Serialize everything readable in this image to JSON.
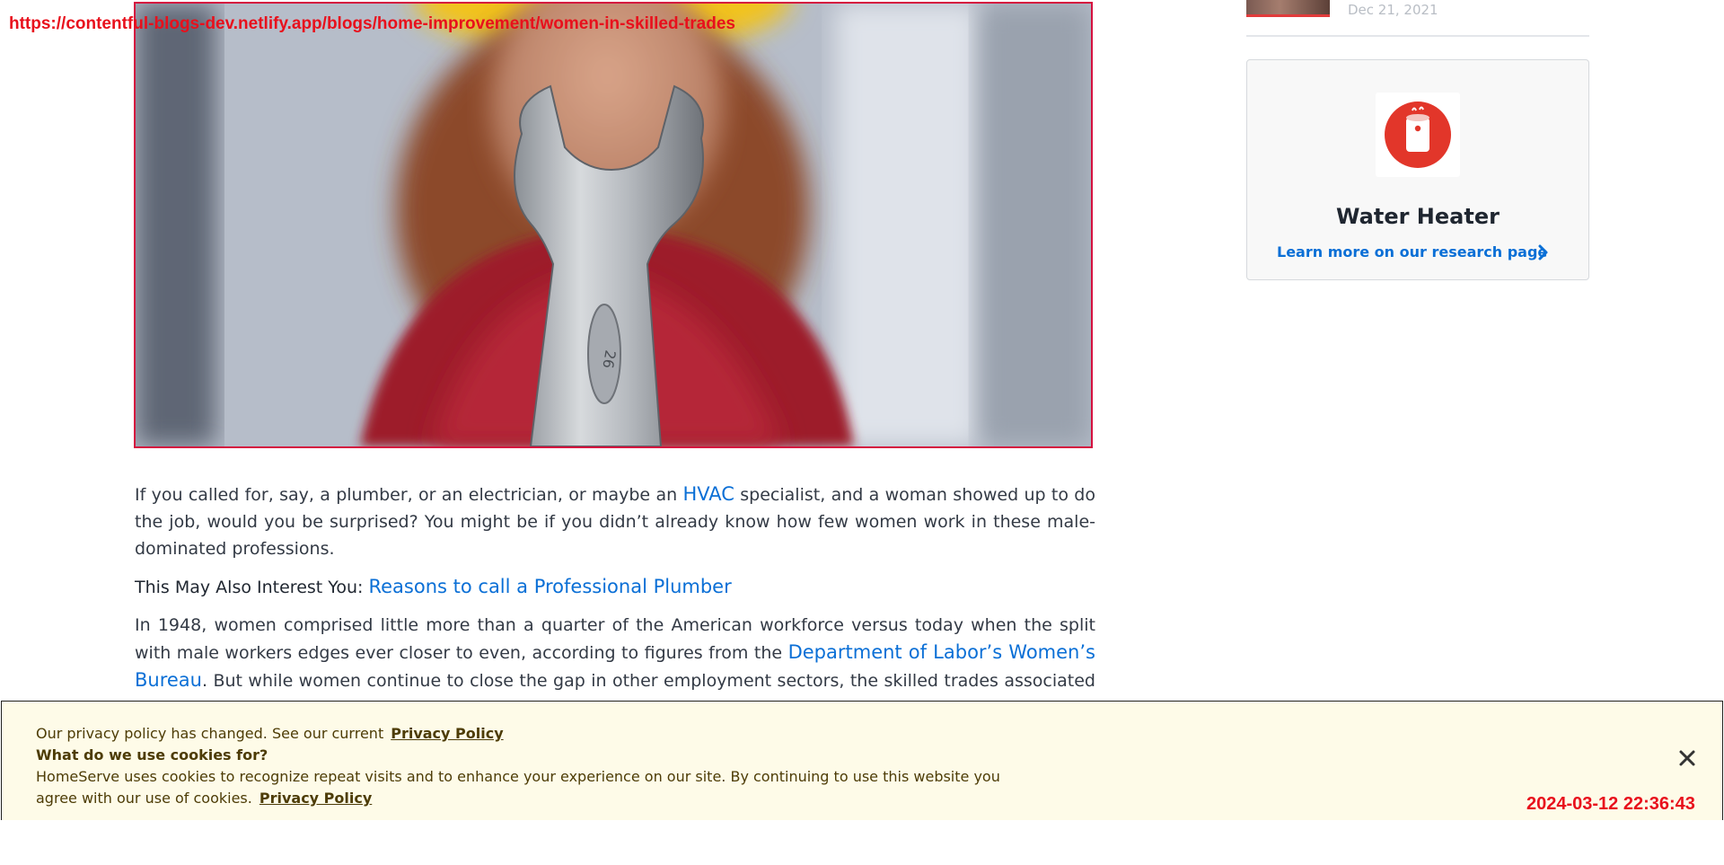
{
  "overlay": {
    "url": "https://contentful-blogs-dev.netlify.app/blogs/home-improvement/women-in-skilled-trades",
    "timestamp": "2024-03-12 22:36:43"
  },
  "hero": {
    "image_semantic": "wrench held in front of blurred worker in hard hat",
    "wrench_marking": "26"
  },
  "article": {
    "p1_before": "If you called for, say, a plumber, or an electrician, or maybe an ",
    "p1_link": "HVAC",
    "p1_after": " specialist, and a woman showed up to do the job, would you be surprised? You might be if you didn’t already know how few women work in these male-dominated professions.",
    "interest_label": "This May Also Interest You: ",
    "interest_link": "Reasons to call a Professional Plumber",
    "p2_before": "In 1948, women comprised little more than a quarter of the American workforce versus today when the split with male workers edges ever closer to even, according to figures from the ",
    "p2_link": "Department of Labor’s Women’s Bureau",
    "p2_after": ". But while women continue to close the gap in other employment sectors, the skilled trades associated with the core functions of"
  },
  "sidebar": {
    "recent_post_date": "Dec 21, 2021",
    "card_title": "Water Heater",
    "card_link": "Learn more on our research page",
    "icon_color": "#e2362a"
  },
  "cookie": {
    "line1_text": "Our privacy policy has changed. See our current",
    "line1_link": "Privacy Policy",
    "line2_text": "What do we use cookies for?",
    "line3_text": "HomeServe uses cookies to recognize repeat visits and to enhance your experience on our site. By continuing to use this website you",
    "line4_text": "agree with our use of cookies.",
    "line4_link": "Privacy Policy"
  },
  "colors": {
    "link": "#0a6fd6",
    "overlay_red": "#e8101c",
    "banner_bg": "#fefbe8",
    "banner_text": "#4d3c06"
  }
}
